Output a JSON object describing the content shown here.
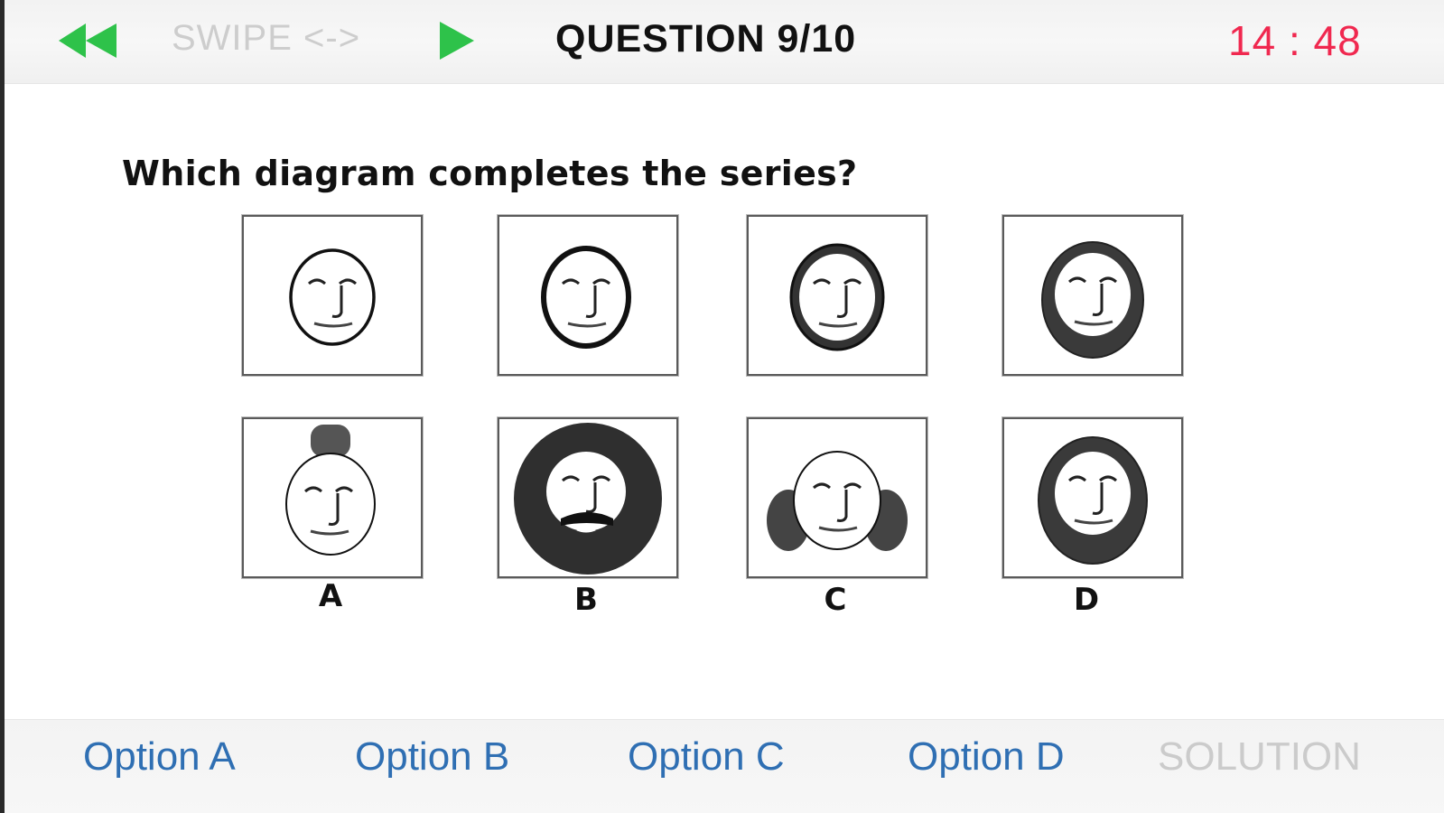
{
  "header": {
    "swipe_label": "SWIPE <->",
    "title": "QUESTION 9/10",
    "timer": "14 : 48",
    "rewind_icon": "rewind-icon",
    "play_icon": "play-icon",
    "accent_green": "#2ec24a",
    "timer_color": "#f0284f"
  },
  "question": {
    "text": "Which diagram completes the series?"
  },
  "answers": {
    "letters": [
      "A",
      "B",
      "C",
      "D"
    ]
  },
  "footer": {
    "option_a": "Option A",
    "option_b": "Option B",
    "option_c": "Option C",
    "option_d": "Option D",
    "solution": "SOLUTION",
    "link_color": "#2f6fb3"
  }
}
